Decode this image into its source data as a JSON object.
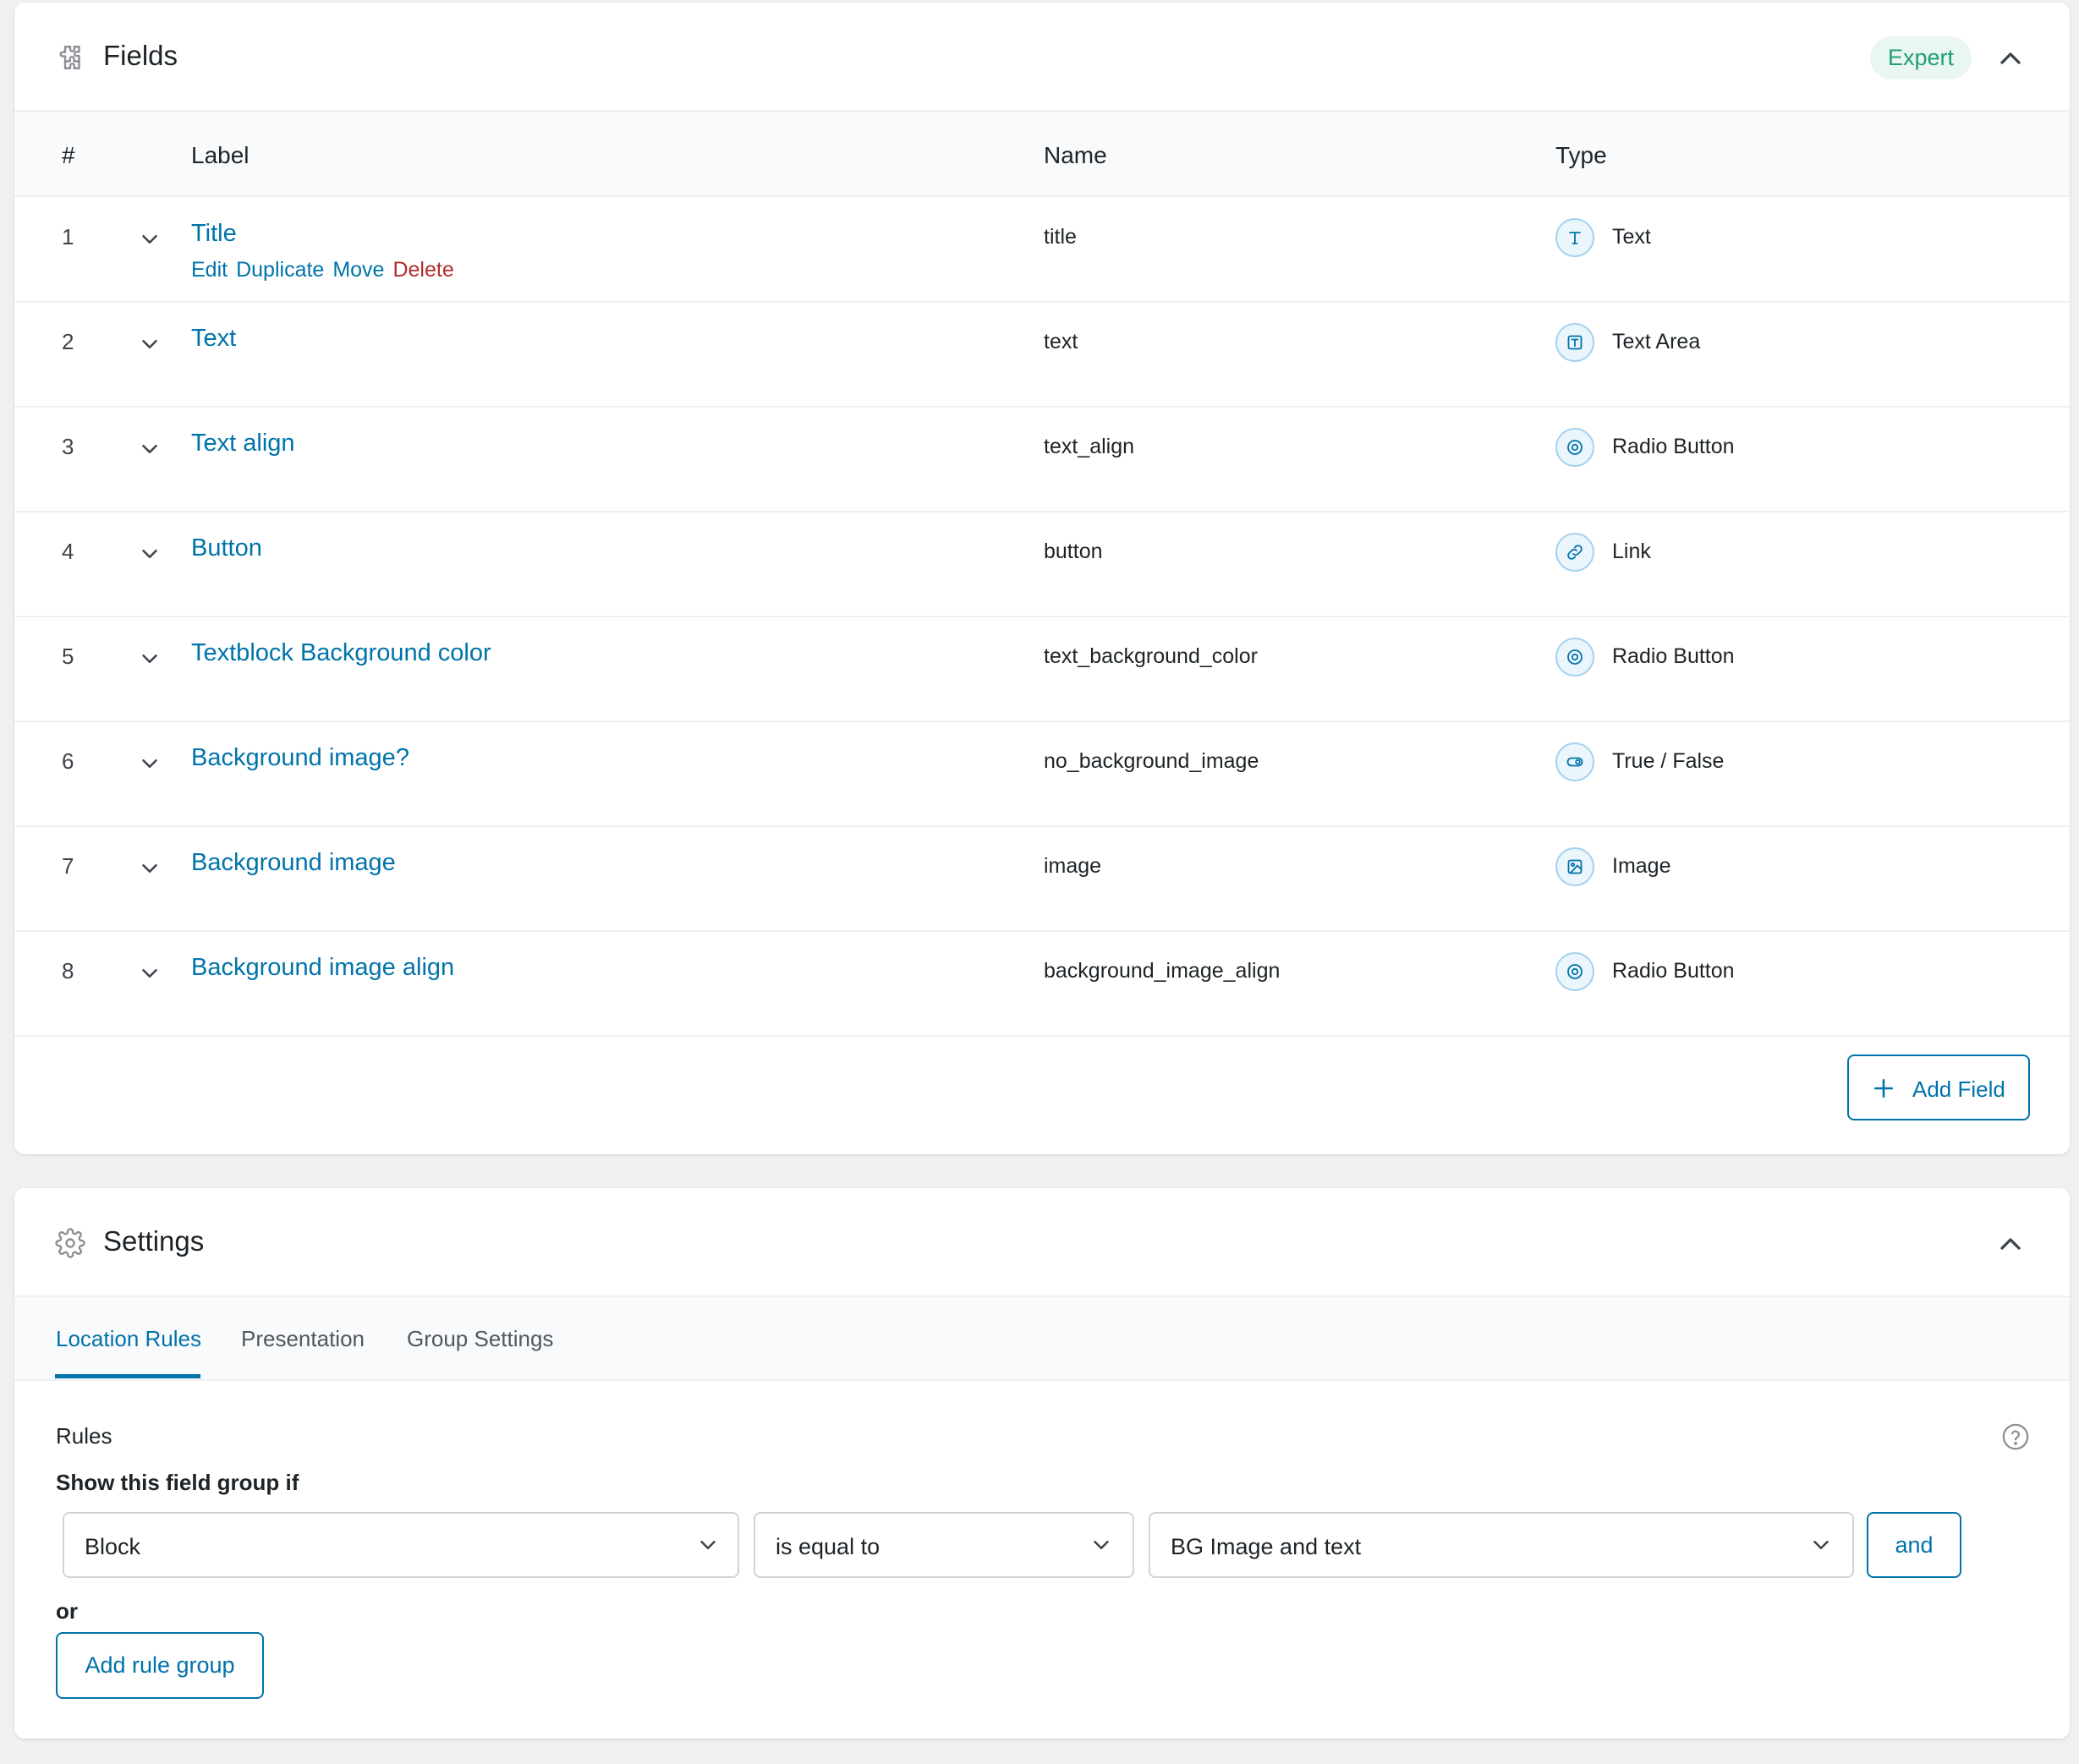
{
  "fields_panel": {
    "title": "Fields",
    "badge": "Expert",
    "columns": {
      "num": "#",
      "label": "Label",
      "name": "Name",
      "type": "Type"
    },
    "rows": [
      {
        "num": "1",
        "label": "Title",
        "name": "title",
        "type": "Text",
        "icon": "text-type-icon"
      },
      {
        "num": "2",
        "label": "Text",
        "name": "text",
        "type": "Text Area",
        "icon": "textarea-type-icon"
      },
      {
        "num": "3",
        "label": "Text align",
        "name": "text_align",
        "type": "Radio Button",
        "icon": "radio-type-icon"
      },
      {
        "num": "4",
        "label": "Button",
        "name": "button",
        "type": "Link",
        "icon": "link-type-icon"
      },
      {
        "num": "5",
        "label": "Textblock Background color",
        "name": "text_background_color",
        "type": "Radio Button",
        "icon": "radio-type-icon"
      },
      {
        "num": "6",
        "label": "Background image?",
        "name": "no_background_image",
        "type": "True / False",
        "icon": "toggle-type-icon"
      },
      {
        "num": "7",
        "label": "Background image",
        "name": "image",
        "type": "Image",
        "icon": "image-type-icon"
      },
      {
        "num": "8",
        "label": "Background image align",
        "name": "background_image_align",
        "type": "Radio Button",
        "icon": "radio-type-icon"
      }
    ],
    "row_actions": {
      "edit": "Edit",
      "duplicate": "Duplicate",
      "move": "Move",
      "delete": "Delete"
    },
    "add_field": "Add Field"
  },
  "settings_panel": {
    "title": "Settings",
    "tabs": [
      "Location Rules",
      "Presentation",
      "Group Settings"
    ],
    "active_tab": "Location Rules",
    "rules_title": "Rules",
    "show_if": "Show this field group if",
    "rule": {
      "param": "Block",
      "operator": "is equal to",
      "value": "BG Image and text"
    },
    "and_label": "and",
    "or_label": "or",
    "add_rule_group": "Add rule group"
  },
  "colors": {
    "accent": "#0073aa",
    "danger": "#b32d2e",
    "badge_text": "#1f9e76",
    "badge_bg": "#e9f6f1",
    "page_bg": "#f0f0f1"
  }
}
